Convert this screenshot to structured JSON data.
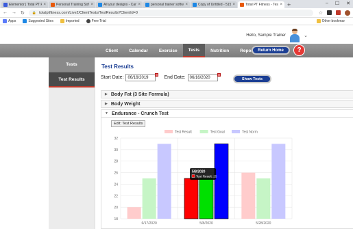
{
  "browser": {
    "tabs": [
      {
        "title": "Elementor | Total PT Fitn",
        "color": "#3b5bdb"
      },
      {
        "title": "Personal Training Softw",
        "color": "#e8590c"
      },
      {
        "title": "All your designs - Canva",
        "color": "#1e88e5"
      },
      {
        "title": "personal trainer softwar",
        "color": "#1e88e5"
      },
      {
        "title": "Copy of Untitled - 515p",
        "color": "#1e88e5"
      },
      {
        "title": "Total PT Fitness - Test Re",
        "color": "#e8590c"
      }
    ],
    "new_tab": "+",
    "window_controls": [
      "–",
      "☐",
      "✕"
    ],
    "url": "totalptfitness.com/Live2/ClientTests/TestResults?ClientId=0",
    "bookmarks": [
      {
        "label": "Apps",
        "color": "#5c7cfa"
      },
      {
        "label": "Suggested Sites",
        "color": "#1e88e5"
      },
      {
        "label": "Imported",
        "color": "#f0c040"
      },
      {
        "label": "Free Trial",
        "color": "#444"
      }
    ],
    "other_bookmarks": "Other bookmar"
  },
  "header": {
    "greeting": "Hello, Sample Trainer"
  },
  "nav": {
    "items": [
      "Client",
      "Calendar",
      "Exercise",
      "Tests",
      "Nutrition",
      "Reports"
    ],
    "active": "Tests",
    "return_home": "Return Home",
    "help": "?"
  },
  "sidebar": {
    "items": [
      "Tests",
      "Test Results"
    ],
    "active": "Test Results"
  },
  "main": {
    "title": "Test Results",
    "start_label": "Start Date:",
    "start_value": "06/16/2019",
    "end_label": "End Date:",
    "end_value": "06/16/2020",
    "show_tests": "Show Tests",
    "sections": [
      {
        "label": "Body Fat (3 Site Formula)",
        "open": false
      },
      {
        "label": "Body Weight",
        "open": false
      },
      {
        "label": "Endurance - Crunch Test",
        "open": true
      }
    ],
    "edit_button": "Edit: Test Results"
  },
  "chart_data": {
    "type": "bar",
    "categories": [
      "6/17/2020",
      "5/8/2020",
      "5/28/2020"
    ],
    "series": [
      {
        "name": "Test Result",
        "values": [
          20,
          25,
          26
        ],
        "color": "#ffcccc",
        "highlight": "#ff0000"
      },
      {
        "name": "Test Goal",
        "values": [
          25,
          25,
          25
        ],
        "color": "#c6f5c6",
        "highlight": "#00e000"
      },
      {
        "name": "Test Norm",
        "values": [
          31,
          31,
          31
        ],
        "color": "#c8c8ff",
        "highlight": "#0000ff"
      }
    ],
    "highlighted_category": "5/8/2020",
    "yticks": [
      18,
      20,
      22,
      24,
      26,
      28,
      30,
      32
    ],
    "ylim": [
      18,
      32
    ],
    "grid": true,
    "legend": "top",
    "tooltip": {
      "title": "5/8/2020",
      "text": "Test Result: 25"
    }
  }
}
